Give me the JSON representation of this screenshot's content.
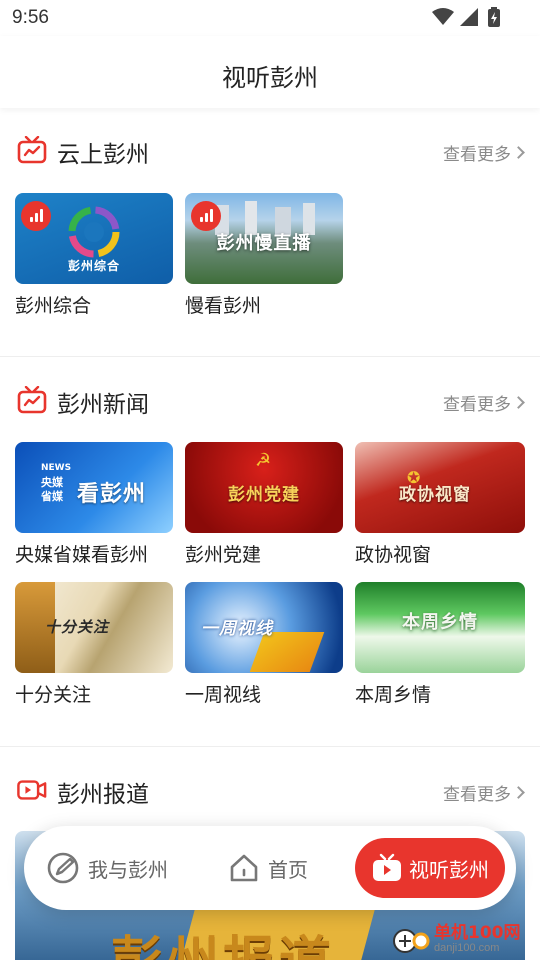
{
  "status_bar": {
    "time": "9:56",
    "icons": [
      "wifi-icon",
      "signal-icon",
      "battery-icon"
    ]
  },
  "header": {
    "title": "视听彭州"
  },
  "colors": {
    "accent": "#e8352d",
    "more_text": "#8a8a8a"
  },
  "sections": [
    {
      "title": "云上彭州",
      "icon": "tv-icon",
      "more": "查看更多",
      "cards": [
        {
          "label": "彭州综合",
          "thumb_text": "彭州综合",
          "live": true
        },
        {
          "label": "慢看彭州",
          "thumb_text": "彭州慢直播",
          "live": true
        }
      ]
    },
    {
      "title": "彭州新闻",
      "icon": "tv-icon",
      "more": "查看更多",
      "cards": [
        {
          "label": "央媒省媒看彭州",
          "thumb_text": "看彭州",
          "thumb_small_1": "NEWS",
          "thumb_small_2": "央媒",
          "thumb_small_3": "省媒"
        },
        {
          "label": "彭州党建",
          "thumb_text": "彭州党建"
        },
        {
          "label": "政协视窗",
          "thumb_text": "政协视窗"
        },
        {
          "label": "十分关注",
          "thumb_text": "十分关注"
        },
        {
          "label": "一周视线",
          "thumb_text": "一周视线"
        },
        {
          "label": "本周乡情",
          "thumb_text": "本周乡情"
        }
      ]
    },
    {
      "title": "彭州报道",
      "icon": "video-icon",
      "more": "查看更多",
      "banner_text": "彭州报道"
    }
  ],
  "bottom_nav": {
    "items": [
      {
        "label": "我与彭州",
        "icon": "edit-circle-icon",
        "active": false
      },
      {
        "label": "首页",
        "icon": "home-icon",
        "active": false
      },
      {
        "label": "视听彭州",
        "icon": "tv-icon",
        "active": true
      }
    ]
  },
  "watermark": {
    "main": "单机100网",
    "sub": "danji100.com"
  }
}
